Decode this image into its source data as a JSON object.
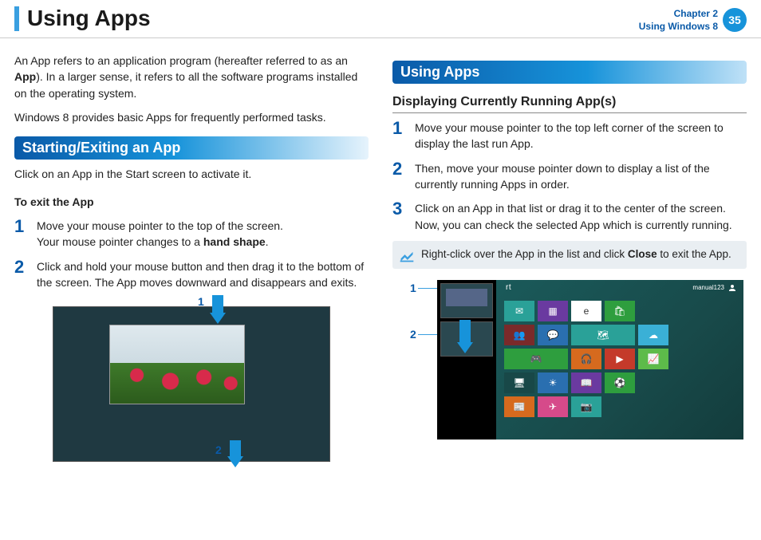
{
  "header": {
    "title": "Using Apps",
    "chapter_line1": "Chapter 2",
    "chapter_line2": "Using Windows 8",
    "page_number": "35"
  },
  "intro": {
    "p1a": "An App refers to an application program (hereafter referred to as an ",
    "p1b": "App",
    "p1c": "). In a larger sense, it refers to all the software programs installed on the operating system.",
    "p2": "Windows 8 provides basic Apps for frequently performed tasks."
  },
  "left": {
    "section_heading": "Starting/Exiting an App",
    "lead": "Click on an App in the Start screen to activate it.",
    "exit_heading": "To exit the App",
    "steps": [
      {
        "num": "1",
        "text_a": " Move your mouse pointer to the top of the screen.\nYour mouse pointer changes to a ",
        "bold": "hand shape",
        "text_b": "."
      },
      {
        "num": "2",
        "text_a": "Click and hold your mouse button and then drag it to the bottom of the screen. The App moves downward and disappears and exits.",
        "bold": "",
        "text_b": ""
      }
    ],
    "fig": {
      "label1": "1",
      "label2": "2"
    }
  },
  "right": {
    "section_heading": "Using Apps",
    "sub_heading": "Displaying Currently Running App(s)",
    "steps": [
      {
        "num": "1",
        "text": "Move your mouse pointer to the top left corner of the screen to display the last run App."
      },
      {
        "num": "2",
        "text": "Then, move your mouse pointer down to display a list of the currently running Apps in order."
      },
      {
        "num": "3",
        "text": "Click on an App in that list or drag it to the center of the screen. Now, you can check the selected App which is currently running."
      }
    ],
    "note_a": "Right-click over the App in the list and click  ",
    "note_bold": "Close",
    "note_b": " to exit the App.",
    "fig": {
      "label1": "1",
      "label2": "2",
      "start_label": "rt",
      "user_label": "manual123"
    }
  }
}
